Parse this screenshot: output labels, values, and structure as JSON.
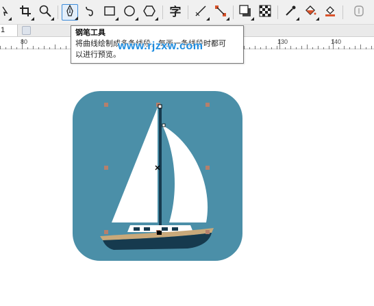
{
  "toolbar": {
    "tools": [
      {
        "name": "pick-tool",
        "icon": "cursor-icon"
      },
      {
        "name": "crop-tool",
        "icon": "crop-icon"
      },
      {
        "name": "zoom-tool",
        "icon": "magnifier-icon"
      },
      {
        "name": "pen-tool",
        "icon": "pen-nib-icon",
        "active": true
      },
      {
        "name": "bspline-tool",
        "icon": "curve-icon"
      },
      {
        "name": "rectangle-tool",
        "icon": "rectangle-icon"
      },
      {
        "name": "ellipse-tool",
        "icon": "ellipse-icon"
      },
      {
        "name": "polygon-tool",
        "icon": "hexagon-icon"
      },
      {
        "name": "text-tool",
        "icon": "text-zi-icon",
        "glyph": "字"
      },
      {
        "name": "dimension-tool",
        "icon": "line-icon"
      },
      {
        "name": "connector-tool",
        "icon": "connector-icon"
      },
      {
        "name": "drop-shadow-tool",
        "icon": "shadow-icon"
      },
      {
        "name": "transparency-tool",
        "icon": "checkerboard-icon"
      },
      {
        "name": "eyedropper-tool",
        "icon": "eyedropper-icon"
      },
      {
        "name": "interactive-fill-tool",
        "icon": "paint-bucket-icon"
      },
      {
        "name": "smart-fill-tool",
        "icon": "smart-fill-icon"
      },
      {
        "name": "extra-tool",
        "icon": "rounded-rect-icon"
      }
    ]
  },
  "propbar": {
    "page_number": "1"
  },
  "ruler": {
    "labels": [
      "80",
      "130",
      "140"
    ]
  },
  "tooltip": {
    "title": "钢笔工具",
    "body_line1": "将曲线绘制成多条线段，每画一条线段时都可",
    "body_line2": "以进行预览。"
  },
  "watermark": {
    "text": "www.rjzxw.com"
  },
  "colors": {
    "icon_bg": "#4b8fa8",
    "sail": "#ffffff",
    "mast": "#163a4e",
    "hull": "#163a4e",
    "deck_stripe": "#c9a97a",
    "node_marker": "#b5806c",
    "accent": "#3c8ad8"
  }
}
